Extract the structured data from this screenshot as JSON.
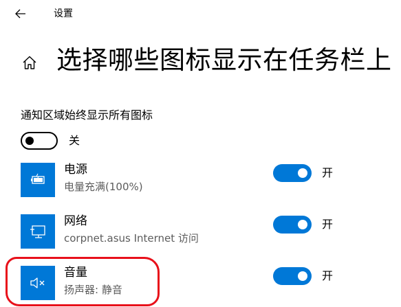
{
  "window": {
    "title": "设置"
  },
  "page": {
    "title": "选择哪些图标显示在任务栏上"
  },
  "master": {
    "label": "通知区域始终显示所有图标",
    "state": "关",
    "on": false
  },
  "items": [
    {
      "name": "电源",
      "desc": "电量充满(100%)",
      "state": "开",
      "on": true,
      "icon": "battery-icon"
    },
    {
      "name": "网络",
      "desc": "corpnet.asus Internet 访问",
      "state": "开",
      "on": true,
      "icon": "network-icon"
    },
    {
      "name": "音量",
      "desc": "扬声器: 静音",
      "state": "开",
      "on": true,
      "icon": "volume-mute-icon"
    }
  ],
  "colors": {
    "accent": "#0078d7",
    "annotation": "#e8101a",
    "secondary_text": "#5c5c5c"
  }
}
